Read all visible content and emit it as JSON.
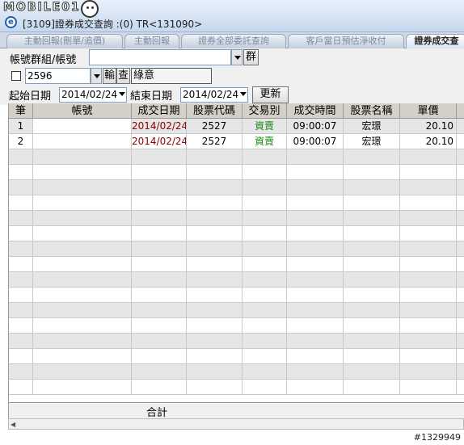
{
  "watermark": {
    "brand": "MOBILE01",
    "id": "#1329949"
  },
  "window": {
    "title": "[3109]證券成交查詢 :(0) TR<131090>"
  },
  "tabs": [
    {
      "label": "主動回報(刪單/追價)",
      "active": false
    },
    {
      "label": "主動回報",
      "active": false
    },
    {
      "label": "證券全部委託查詢",
      "active": false
    },
    {
      "label": "客戶當日預估淨收付",
      "active": false
    },
    {
      "label": "證券成交查",
      "active": true
    }
  ],
  "filters": {
    "account_group_label": "帳號群組/帳號",
    "account_group_value": "",
    "group_button": "群",
    "stock_code": "2596",
    "lookup_button_input": "輸",
    "lookup_button_query": "查",
    "stock_name": "綠意",
    "start_date_label": "起始日期",
    "start_date": "2014/02/24",
    "end_date_label": "結束日期",
    "end_date": "2014/02/24",
    "refresh_button": "更新"
  },
  "table": {
    "columns": [
      "筆",
      "帳號",
      "成交日期",
      "股票代碼",
      "交易別",
      "成交時間",
      "股票名稱",
      "單價",
      ""
    ],
    "rows": [
      {
        "no": "1",
        "account": "",
        "date": "2014/02/24",
        "code": "2527",
        "side": "資賣",
        "time": "09:00:07",
        "name": "宏璟",
        "price": "20.10"
      },
      {
        "no": "2",
        "account": "",
        "date": "2014/02/24",
        "code": "2527",
        "side": "資賣",
        "time": "09:00:07",
        "name": "宏璟",
        "price": "20.10"
      }
    ],
    "total_label": "合計"
  },
  "colors": {
    "side_text": "#1a8a1a",
    "date_text": "#8b0000"
  }
}
